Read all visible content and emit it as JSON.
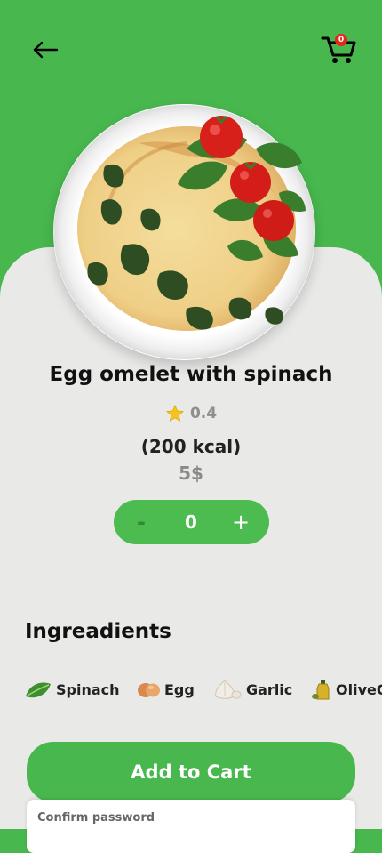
{
  "header": {
    "back_icon": "arrow-left-icon",
    "cart_icon": "shopping-cart-icon",
    "cart_count": "0"
  },
  "product": {
    "image_description_icon": "omelet-plate",
    "name": "Egg omelet with spinach",
    "rating": "0.4",
    "rating_icon": "star-icon",
    "calories": "(200 kcal)",
    "price": "5$"
  },
  "quantity": {
    "minus_label": "-",
    "value": "0",
    "plus_label": "+"
  },
  "ingredients": {
    "title": "Ingreadients",
    "items": [
      {
        "label": "Spinach",
        "icon": "spinach-icon"
      },
      {
        "label": "Egg",
        "icon": "egg-icon"
      },
      {
        "label": "Garlic",
        "icon": "garlic-icon"
      },
      {
        "label": "OliveOil",
        "icon": "olive-oil-icon"
      }
    ]
  },
  "actions": {
    "add_to_cart_label": "Add to Cart"
  },
  "confirm_sheet": {
    "label": "Confirm password"
  },
  "colors": {
    "primary_green": "#48b84e",
    "sheet_background": "#e9e9e7",
    "badge_red": "#e5281f",
    "star_yellow": "#f6c21c"
  }
}
